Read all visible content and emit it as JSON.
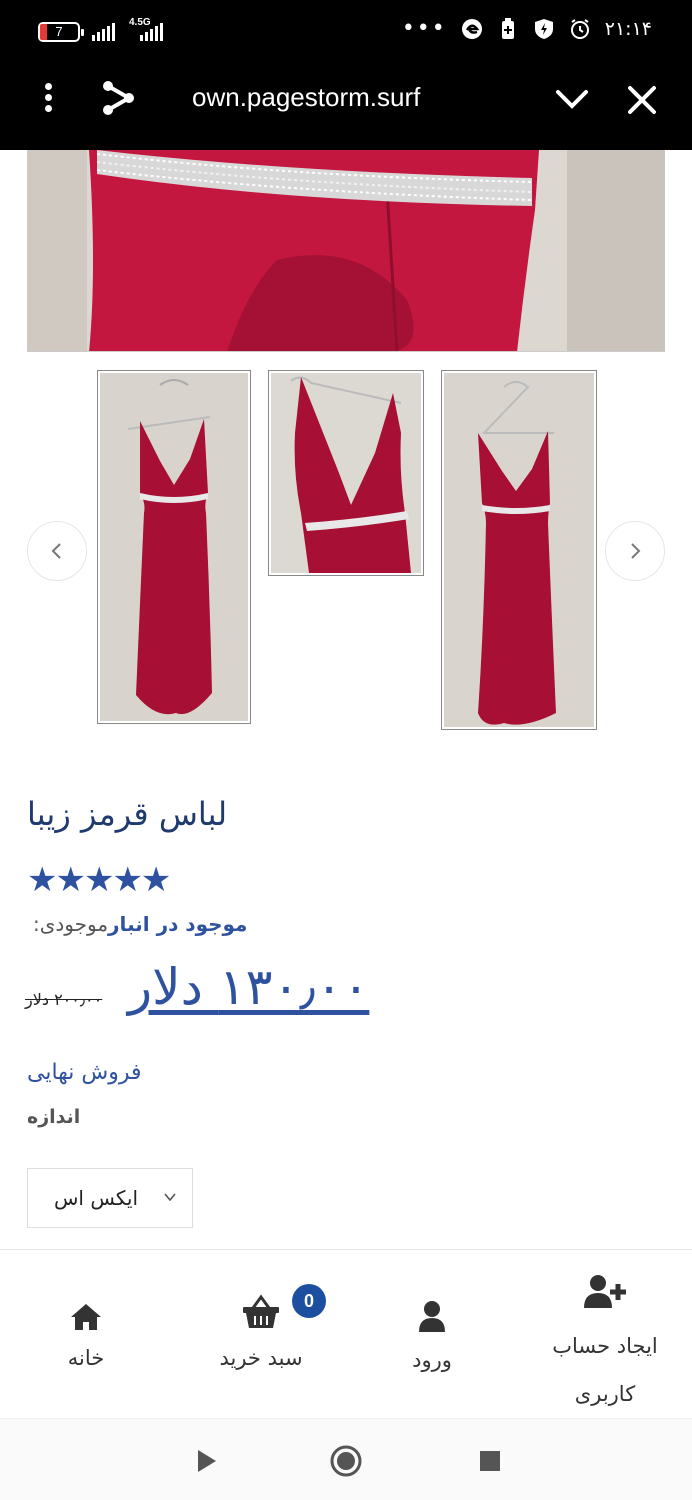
{
  "status_bar": {
    "battery_level": "7",
    "network_type": "4.5G",
    "clock": "۲۱:۱۴",
    "more_icon": "more-dots-icon"
  },
  "browser": {
    "url": "own.pagestorm.surf",
    "menu_icon": "kebab-menu-icon",
    "share_icon": "share-icon",
    "collapse_icon": "chevron-down-icon",
    "close_icon": "close-icon"
  },
  "product": {
    "title": "لباس قرمز زیبا",
    "rating": 5,
    "stars": "★★★★★",
    "stock_label": "موجودی:",
    "stock_value": "موجود در انبار",
    "old_price": "۲۰۰٫۰۰ دلار",
    "new_price": "۱۳۰٫۰۰ دلار",
    "final_sale": "فروش نهایی",
    "size_label": "اندازه",
    "size_selected": "ایکس اس"
  },
  "carousel": {
    "prev_icon": "chevron-left-icon",
    "next_icon": "chevron-right-icon"
  },
  "colors": {
    "accent": "#2f52a0",
    "badge": "#1c4fa0",
    "dress": "#b0123c"
  },
  "bottom_nav": {
    "home": "خانه",
    "cart": "سبد خرید",
    "cart_count": "0",
    "login": "ورود",
    "register": "ایجاد حساب کاربری"
  }
}
